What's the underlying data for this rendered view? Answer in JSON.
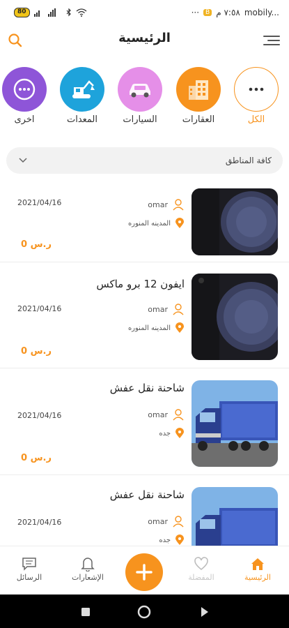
{
  "status_bar": {
    "battery": "80",
    "time": "٧:٥٨ م",
    "carrier": "mobily...",
    "dots": "···"
  },
  "header": {
    "title": "الرئيسية"
  },
  "categories": [
    {
      "label": "الكل",
      "icon": "more-dots-icon",
      "active": true
    },
    {
      "label": "العقارات",
      "icon": "building-icon"
    },
    {
      "label": "السيارات",
      "icon": "car-icon"
    },
    {
      "label": "المعدات",
      "icon": "excavator-icon"
    },
    {
      "label": "اخرى",
      "icon": "more-dots-icon"
    }
  ],
  "region": {
    "label": "كافة المناطق"
  },
  "listings": [
    {
      "title": "",
      "user": "omar",
      "location": "المدينه المنوره",
      "date": "2021/04/16",
      "price": "0 ر.س",
      "image": "phone"
    },
    {
      "title": "ايفون 12 برو ماكس",
      "user": "omar",
      "location": "المدينه المنوره",
      "date": "2021/04/16",
      "price": "0 ر.س",
      "image": "phone"
    },
    {
      "title": "شاحنة نقل عفش",
      "user": "omar",
      "location": "جده",
      "date": "2021/04/16",
      "price": "0 ر.س",
      "image": "truck"
    },
    {
      "title": "شاحنة نقل عفش",
      "user": "omar",
      "location": "جده",
      "date": "2021/04/16",
      "price": "",
      "image": "truck"
    }
  ],
  "bottom_nav": {
    "home": "الرئيسية",
    "favorites": "المفضلة",
    "notifications": "الإشعارات",
    "messages": "الرسائل"
  },
  "colors": {
    "accent": "#f7931e",
    "cars": "#e58fe8",
    "equipment": "#1ea3db",
    "other": "#8e55d8"
  }
}
